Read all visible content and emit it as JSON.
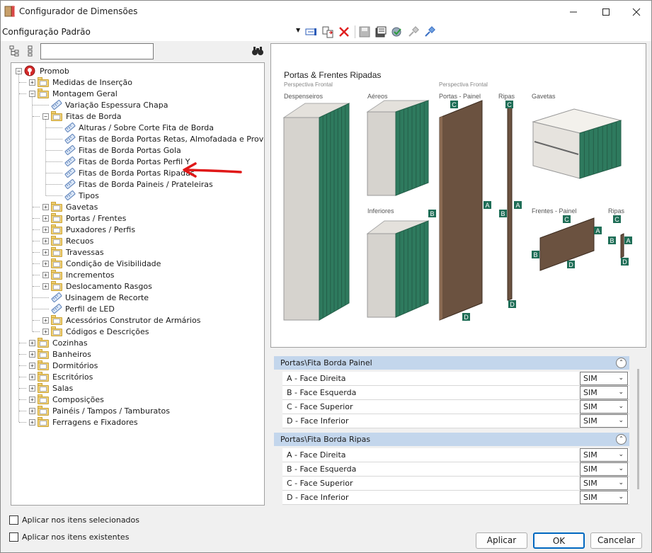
{
  "window": {
    "title": "Configurador de Dimensões"
  },
  "toolbar": {
    "config_name": "Configuração Padrão"
  },
  "search": {
    "value": ""
  },
  "tree": {
    "root": "Promob",
    "items": [
      "Medidas de Inserção",
      "Montagem Geral",
      "Variação Espessura Chapa",
      "Fitas de Borda",
      "Alturas / Sobre Corte Fita de Borda",
      "Fitas de Borda Portas Retas, Almofadada e Provençal",
      "Fitas de Borda Portas Gola",
      "Fitas de Borda Portas Perfil Y",
      "Fitas de Borda Portas Ripadas",
      "Fitas de Borda Paineis / Prateleiras",
      "Tipos",
      "Gavetas",
      "Portas / Frentes",
      "Puxadores / Perfis",
      "Recuos",
      "Travessas",
      "Condição de Visibilidade",
      "Incrementos",
      "Deslocamento Rasgos",
      "Usinagem de Recorte",
      "Perfil de LED",
      "Acessórios Construtor de Armários",
      "Códigos e Descrições",
      "Cozinhas",
      "Banheiros",
      "Dormitórios",
      "Escritórios",
      "Salas",
      "Composições",
      "Painéis / Tampos / Tamburatos",
      "Ferragens e Fixadores"
    ]
  },
  "preview": {
    "title": "Portas & Frentes Ripadas",
    "subtitle_left": "Perspectiva Frontal",
    "subtitle_right": "Perspectiva Frontal",
    "labels": [
      "Despenseiros",
      "Aéreos",
      "Inferiores",
      "Portas - Painel",
      "Ripas",
      "Gavetas",
      "Frentes - Painel",
      "Ripas"
    ],
    "markers": {
      "a": "A",
      "b": "B",
      "c": "C",
      "d": "D"
    },
    "colors": {
      "green": "#2e7a5e",
      "slat": "#3f8f72",
      "wood": "#6b5240",
      "carcass": "#d6d3ce",
      "marker": "#1f6e57"
    }
  },
  "properties": {
    "sections": [
      {
        "title": "Portas\\Fita Borda Painel",
        "rows": [
          {
            "label": "A - Face Direita",
            "value": "SIM"
          },
          {
            "label": "B - Face Esquerda",
            "value": "SIM"
          },
          {
            "label": "C - Face Superior",
            "value": "SIM"
          },
          {
            "label": "D - Face Inferior",
            "value": "SIM"
          }
        ]
      },
      {
        "title": "Portas\\Fita Borda Ripas",
        "rows": [
          {
            "label": "A - Face Direita",
            "value": "SIM"
          },
          {
            "label": "B - Face Esquerda",
            "value": "SIM"
          },
          {
            "label": "C - Face Superior",
            "value": "SIM"
          },
          {
            "label": "D - Face Inferior",
            "value": "SIM"
          }
        ]
      }
    ]
  },
  "options": {
    "apply_selected": "Aplicar nos itens selecionados",
    "apply_existing": "Aplicar nos itens existentes"
  },
  "buttons": {
    "apply": "Aplicar",
    "ok": "OK",
    "cancel": "Cancelar"
  }
}
